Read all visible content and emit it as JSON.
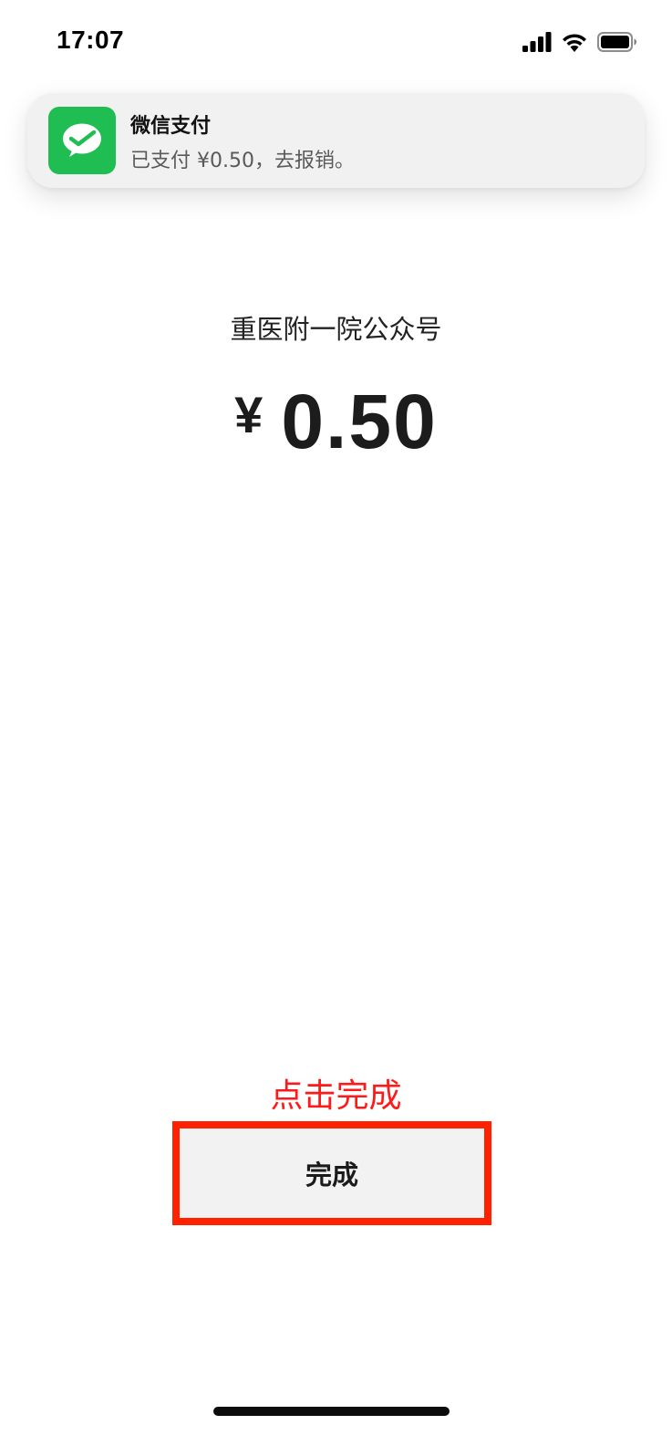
{
  "status_bar": {
    "time": "17:07",
    "icons": [
      "cellular-signal-icon",
      "wifi-icon",
      "battery-icon"
    ]
  },
  "notification": {
    "app_icon": "wechat-pay-icon",
    "app_name": "微信支付",
    "message": "已支付 ¥0.50，去报销。",
    "colors": {
      "icon_bg": "#1fbd52"
    }
  },
  "payment": {
    "merchant": "重医附一院公众号",
    "currency_symbol": "¥",
    "amount": "0.50"
  },
  "annotation": {
    "text": "点击完成",
    "color": "#ff1a1a",
    "box_color": "#ff2200"
  },
  "actions": {
    "done_label": "完成"
  }
}
